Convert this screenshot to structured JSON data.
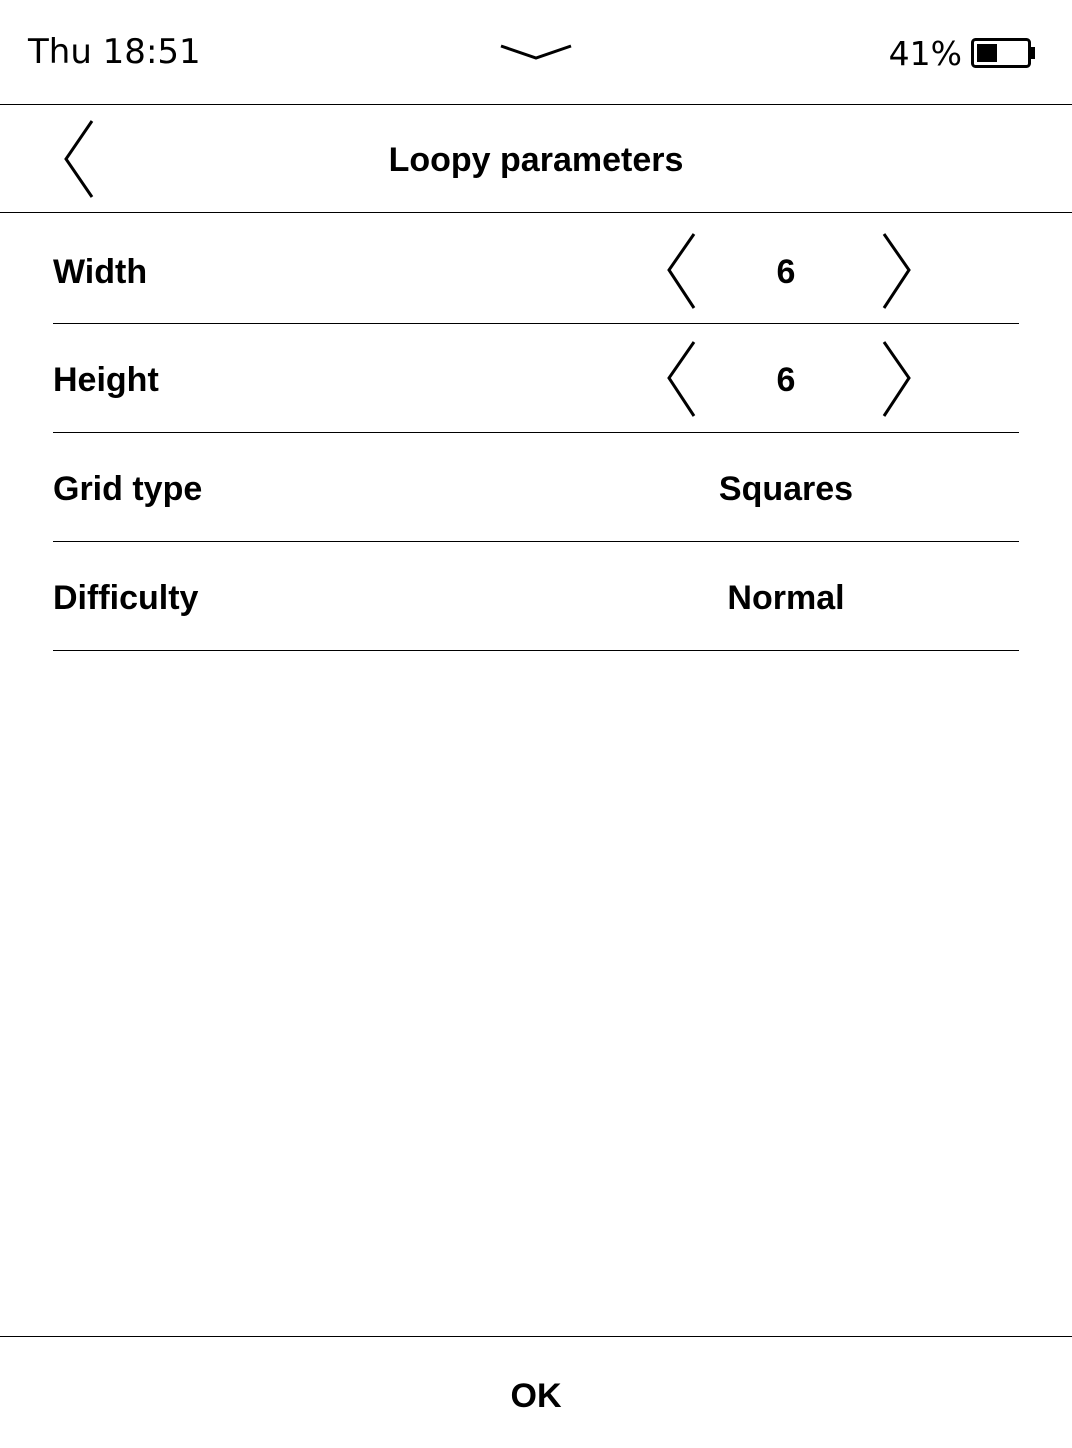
{
  "status_bar": {
    "time": "Thu 18:51",
    "battery_percent": "41%",
    "battery_level": 0.41,
    "pulldown_icon": "chevron-down-icon",
    "battery_icon": "battery-icon"
  },
  "header": {
    "title": "Loopy parameters",
    "back_icon": "chevron-left-icon"
  },
  "params": [
    {
      "label": "Width",
      "value": "6",
      "type": "stepper"
    },
    {
      "label": "Height",
      "value": "6",
      "type": "stepper"
    },
    {
      "label": "Grid type",
      "value": "Squares",
      "type": "choice"
    },
    {
      "label": "Difficulty",
      "value": "Normal",
      "type": "choice"
    }
  ],
  "footer": {
    "ok_label": "OK"
  },
  "colors": {
    "foreground": "#000000",
    "background": "#ffffff"
  }
}
